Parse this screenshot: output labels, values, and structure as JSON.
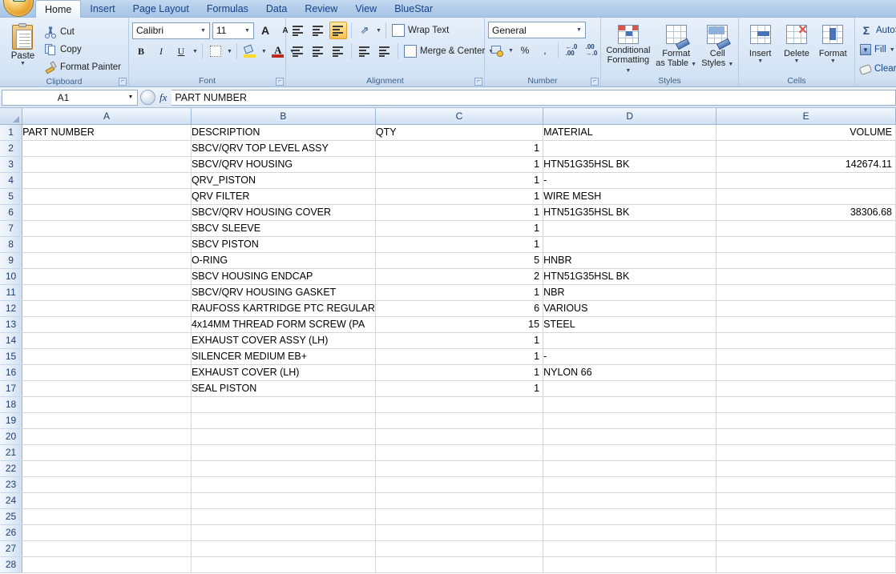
{
  "app": {
    "office_button": "office-orb",
    "tabs": [
      {
        "label": "Home",
        "active": true
      },
      {
        "label": "Insert",
        "active": false
      },
      {
        "label": "Page Layout",
        "active": false
      },
      {
        "label": "Formulas",
        "active": false
      },
      {
        "label": "Data",
        "active": false
      },
      {
        "label": "Review",
        "active": false
      },
      {
        "label": "View",
        "active": false
      },
      {
        "label": "BlueStar",
        "active": false
      }
    ]
  },
  "ribbon": {
    "clipboard": {
      "label": "Clipboard",
      "paste": "Paste",
      "cut": "Cut",
      "copy": "Copy",
      "format_painter": "Format Painter"
    },
    "font": {
      "label": "Font",
      "font_name": "Calibri",
      "font_size": "11",
      "bold": "B",
      "italic": "I",
      "underline": "U",
      "grow_font": "A",
      "shrink_font": "A",
      "font_color": "A"
    },
    "alignment": {
      "label": "Alignment",
      "wrap_text": "Wrap Text",
      "merge_center": "Merge & Center"
    },
    "number": {
      "label": "Number",
      "format": "General",
      "percent": "%",
      "comma": ","
    },
    "styles": {
      "label": "Styles",
      "conditional_formatting": "Conditional\nFormatting",
      "conditional_formatting_l1": "Conditional",
      "conditional_formatting_l2": "Formatting",
      "format_as_table_l1": "Format",
      "format_as_table_l2": "as Table",
      "cell_styles_l1": "Cell",
      "cell_styles_l2": "Styles"
    },
    "cells": {
      "label": "Cells",
      "insert": "Insert",
      "delete": "Delete",
      "format": "Format"
    },
    "editing": {
      "autosum": "AutoS",
      "fill": "Fill",
      "clear": "Clear"
    }
  },
  "formula_bar": {
    "name_box": "A1",
    "fx": "fx",
    "content": "PART NUMBER"
  },
  "sheet": {
    "columns": [
      "A",
      "B",
      "C",
      "D",
      "E"
    ],
    "row_numbers": [
      1,
      2,
      3,
      4,
      5,
      6,
      7,
      8,
      9,
      10,
      11,
      12,
      13,
      14,
      15,
      16,
      17,
      18,
      19,
      20,
      21,
      22,
      23,
      24,
      25,
      26,
      27,
      28
    ],
    "header_row": {
      "A": "PART NUMBER",
      "B": "DESCRIPTION",
      "C": "QTY",
      "D": "MATERIAL",
      "E": "VOLUME"
    },
    "rows": [
      {
        "n": 1,
        "A": "PART NUMBER",
        "B": "DESCRIPTION",
        "C": "QTY",
        "D": "MATERIAL",
        "E": "VOLUME",
        "c_num": false
      },
      {
        "n": 2,
        "A": "",
        "B": "SBCV/QRV TOP LEVEL ASSY",
        "C": "1",
        "D": "",
        "E": "",
        "c_num": true
      },
      {
        "n": 3,
        "A": "",
        "B": "SBCV/QRV HOUSING",
        "C": "1",
        "D": "HTN51G35HSL BK",
        "E": "142674.11",
        "c_num": true
      },
      {
        "n": 4,
        "A": "",
        "B": "QRV_PISTON",
        "C": "1",
        "D": "-",
        "E": "",
        "c_num": true
      },
      {
        "n": 5,
        "A": "",
        "B": "QRV FILTER",
        "C": "1",
        "D": "WIRE MESH",
        "E": "",
        "c_num": true
      },
      {
        "n": 6,
        "A": "",
        "B": "SBCV/QRV HOUSING COVER",
        "C": "1",
        "D": "HTN51G35HSL BK",
        "E": "38306.68",
        "c_num": true
      },
      {
        "n": 7,
        "A": "",
        "B": "SBCV SLEEVE",
        "C": "1",
        "D": "",
        "E": "",
        "c_num": true
      },
      {
        "n": 8,
        "A": "",
        "B": "SBCV PISTON",
        "C": "1",
        "D": "",
        "E": "",
        "c_num": true
      },
      {
        "n": 9,
        "A": "",
        "B": "O-RING",
        "C": "5",
        "D": "HNBR",
        "E": "",
        "c_num": true
      },
      {
        "n": 10,
        "A": "",
        "B": "SBCV HOUSING ENDCAP",
        "C": "2",
        "D": "HTN51G35HSL BK",
        "E": "",
        "c_num": true
      },
      {
        "n": 11,
        "A": "",
        "B": "SBCV/QRV  HOUSING GASKET",
        "C": "1",
        "D": "NBR",
        "E": "",
        "c_num": true
      },
      {
        "n": 12,
        "A": "",
        "B": "RAUFOSS KARTRIDGE PTC REGULAR",
        "C": "6",
        "D": "VARIOUS",
        "E": "",
        "c_num": true
      },
      {
        "n": 13,
        "A": "",
        "B": "4x14MM THREAD FORM SCREW (PA",
        "C": "15",
        "D": "STEEL",
        "E": "",
        "c_num": true
      },
      {
        "n": 14,
        "A": "",
        "B": "EXHAUST COVER ASSY (LH)",
        "C": "1",
        "D": "",
        "E": "",
        "c_num": true
      },
      {
        "n": 15,
        "A": "",
        "B": "SILENCER MEDIUM EB+",
        "C": "1",
        "D": "-",
        "E": "",
        "c_num": true
      },
      {
        "n": 16,
        "A": "",
        "B": "EXHAUST COVER (LH)",
        "C": "1",
        "D": "NYLON 66",
        "E": "",
        "c_num": true
      },
      {
        "n": 17,
        "A": "",
        "B": "SEAL PISTON",
        "C": "1",
        "D": "",
        "E": "",
        "c_num": true
      },
      {
        "n": 18,
        "A": "",
        "B": "",
        "C": "",
        "D": "",
        "E": "",
        "c_num": false
      },
      {
        "n": 19,
        "A": "",
        "B": "",
        "C": "",
        "D": "",
        "E": "",
        "c_num": false
      },
      {
        "n": 20,
        "A": "",
        "B": "",
        "C": "",
        "D": "",
        "E": "",
        "c_num": false
      },
      {
        "n": 21,
        "A": "",
        "B": "",
        "C": "",
        "D": "",
        "E": "",
        "c_num": false
      },
      {
        "n": 22,
        "A": "",
        "B": "",
        "C": "",
        "D": "",
        "E": "",
        "c_num": false
      },
      {
        "n": 23,
        "A": "",
        "B": "",
        "C": "",
        "D": "",
        "E": "",
        "c_num": false
      },
      {
        "n": 24,
        "A": "",
        "B": "",
        "C": "",
        "D": "",
        "E": "",
        "c_num": false
      },
      {
        "n": 25,
        "A": "",
        "B": "",
        "C": "",
        "D": "",
        "E": "",
        "c_num": false
      },
      {
        "n": 26,
        "A": "",
        "B": "",
        "C": "",
        "D": "",
        "E": "",
        "c_num": false
      },
      {
        "n": 27,
        "A": "",
        "B": "",
        "C": "",
        "D": "",
        "E": "",
        "c_num": false
      },
      {
        "n": 28,
        "A": "",
        "B": "",
        "C": "",
        "D": "",
        "E": "",
        "c_num": false
      }
    ]
  },
  "colors": {
    "ribbon_blue": "#d2e2f4",
    "tab_text": "#15428b",
    "header_blue": "#cfdff1",
    "grid_line": "#d6d6d6",
    "accent_orange": "#fbbf4e"
  }
}
